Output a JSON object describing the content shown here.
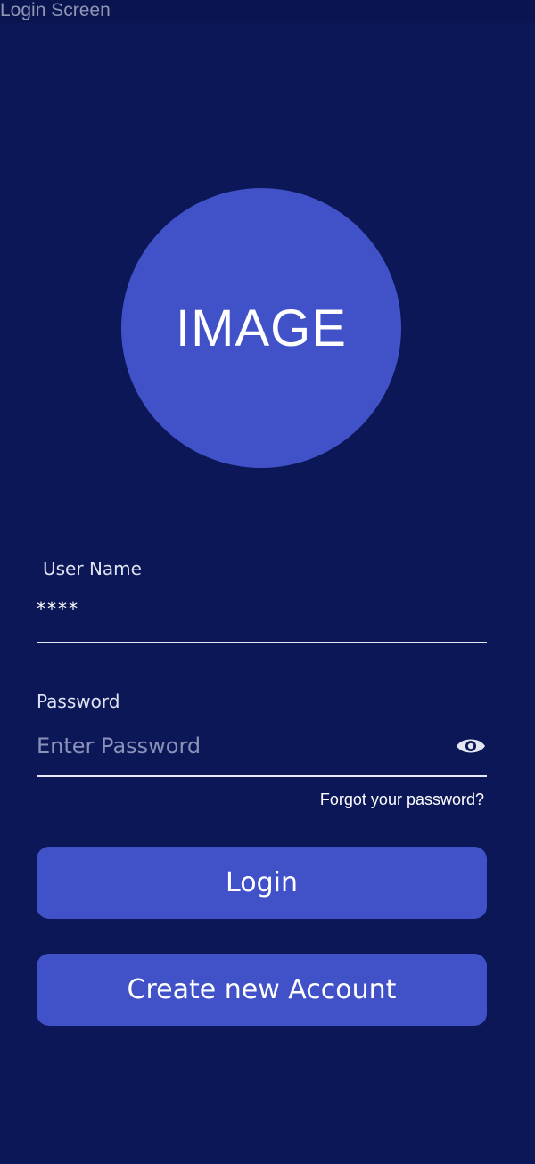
{
  "window": {
    "title": "Login Screen"
  },
  "avatar": {
    "text": "IMAGE"
  },
  "username": {
    "label": "User Name",
    "value": "****"
  },
  "password": {
    "label": "Password",
    "placeholder": "Enter Password",
    "icon": "eye-icon"
  },
  "forgot": {
    "label": "Forgot your password?"
  },
  "buttons": {
    "login": "Login",
    "create_account": "Create new Account"
  },
  "colors": {
    "background": "#0c1757",
    "accent": "#4152c9",
    "text": "#ffffff"
  }
}
